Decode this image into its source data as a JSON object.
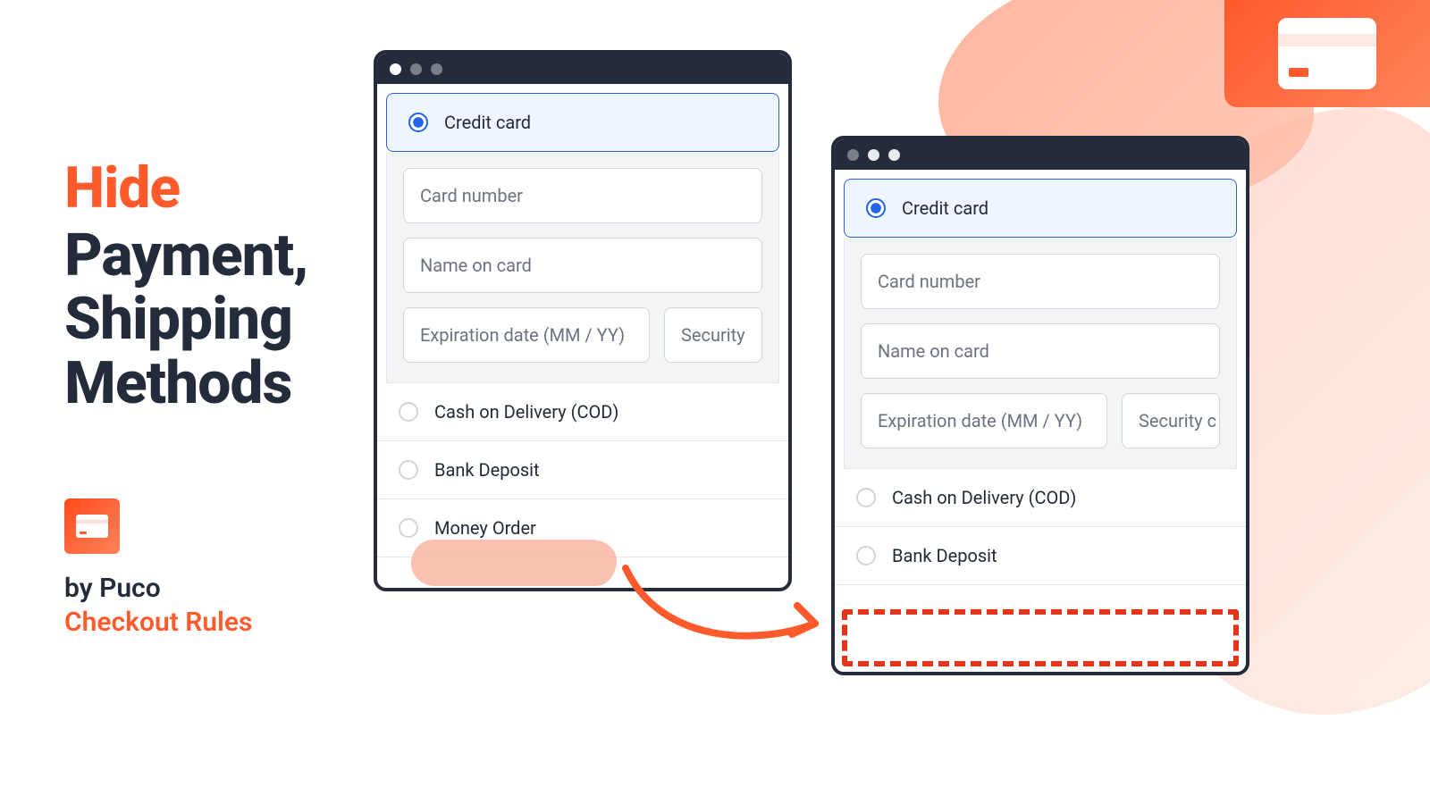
{
  "headline": {
    "accent": "Hide",
    "line2": "Payment,",
    "line3": "Shipping",
    "line4": "Methods"
  },
  "brand": {
    "by": "by Puco",
    "product": "Checkout Rules"
  },
  "window1": {
    "selected_method": "Credit card",
    "fields": {
      "card_number": "Card number",
      "name_on_card": "Name on card",
      "expiration": "Expiration date (MM / YY)",
      "security": "Security"
    },
    "other_methods": [
      "Cash on Delivery (COD)",
      "Bank Deposit",
      "Money Order"
    ]
  },
  "window2": {
    "selected_method": "Credit card",
    "fields": {
      "card_number": "Card number",
      "name_on_card": "Name on card",
      "expiration": "Expiration date (MM / YY)",
      "security": "Security c"
    },
    "other_methods": [
      "Cash on Delivery (COD)",
      "Bank Deposit"
    ]
  }
}
